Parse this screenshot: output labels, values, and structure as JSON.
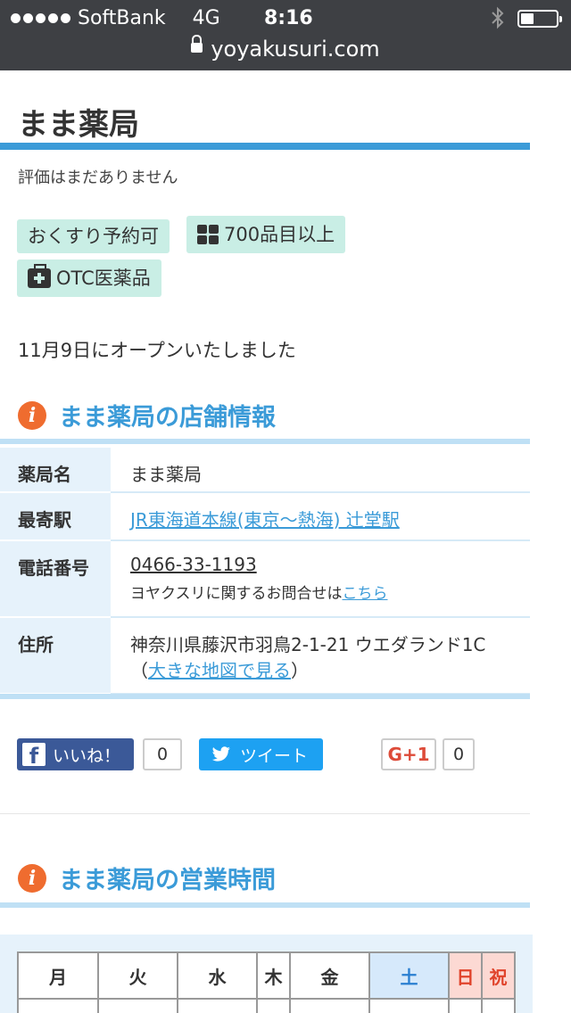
{
  "status_bar": {
    "carrier": "SoftBank",
    "network": "4G",
    "time": "8:16",
    "url": "yoyakusuri.com"
  },
  "page": {
    "title": "まま薬局",
    "rating_text": "評価はまだありません",
    "tags": [
      {
        "label": "おくすり予約可",
        "icon": "none"
      },
      {
        "label": "700品目以上",
        "icon": "grid-icon"
      },
      {
        "label": "OTC医薬品",
        "icon": "medical-kit-icon"
      }
    ],
    "notice": "11月9日にオープンいたしました"
  },
  "store_info": {
    "heading": "まま薬局の店舗情報",
    "rows": {
      "name_label": "薬局名",
      "name_value": "まま薬局",
      "station_label": "最寄駅",
      "station_value": "JR東海道本線(東京〜熱海) 辻堂駅",
      "phone_label": "電話番号",
      "phone_value": "0466-33-1193",
      "inquiry_prefix": "ヨヤクスリに関するお問合せは",
      "inquiry_link": "こちら",
      "address_label": "住所",
      "address_value": "神奈川県藤沢市羽鳥2-1-21 ウエダランド1C",
      "map_open": "（",
      "map_link": "大きな地図で見る",
      "map_close": "）"
    }
  },
  "social": {
    "facebook_label": "いいね！",
    "facebook_count": "0",
    "twitter_label": "ツイート",
    "gplus_label": "G+1",
    "gplus_count": "0"
  },
  "hours": {
    "heading": "まま薬局の営業時間",
    "days": [
      "月",
      "火",
      "水",
      "木",
      "金",
      "土",
      "日",
      "祝"
    ]
  },
  "colors": {
    "accent_blue": "#3b9bd8",
    "tag_bg": "#c9eee5",
    "info_orange": "#ef6c2f",
    "facebook": "#3b5998",
    "twitter": "#1da1f2"
  }
}
